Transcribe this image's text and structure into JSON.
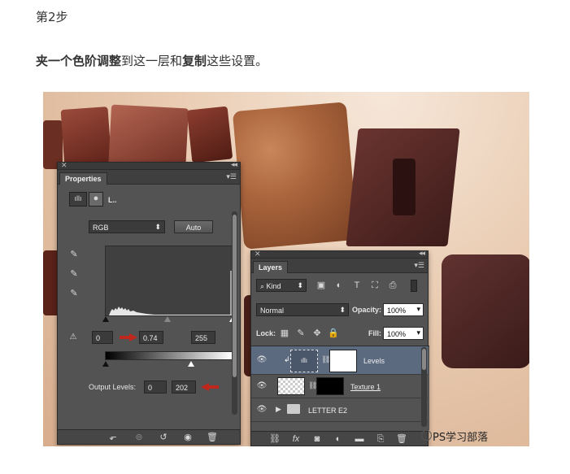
{
  "article": {
    "step_title": "第2步",
    "desc_bold_1": "夹一个",
    "desc_bold_2": "色阶调整",
    "desc_mid": "到这一层和",
    "desc_bold_3": "复制",
    "desc_end": "这些设置。"
  },
  "properties_panel": {
    "tab_label": "Properties",
    "header_label": "L..",
    "channel_select": "RGB",
    "auto_button": "Auto",
    "input_black": "0",
    "input_gamma": "0.74",
    "input_white": "255",
    "output_label": "Output Levels:",
    "output_black": "0",
    "output_white": "202"
  },
  "layers_panel": {
    "tab_label": "Layers",
    "filter_select": "Kind",
    "blend_mode": "Normal",
    "opacity_label": "Opacity:",
    "opacity_value": "100%",
    "lock_label": "Lock:",
    "fill_label": "Fill:",
    "fill_value": "100%",
    "layers": [
      {
        "name": "Levels"
      },
      {
        "name": "Texture 1"
      },
      {
        "name": "LETTER E2"
      }
    ]
  },
  "watermark": "PS学习部落",
  "colors": {
    "panel_bg": "#535353",
    "selected_layer": "#5c6a80",
    "arrow_red": "#c0281e"
  }
}
